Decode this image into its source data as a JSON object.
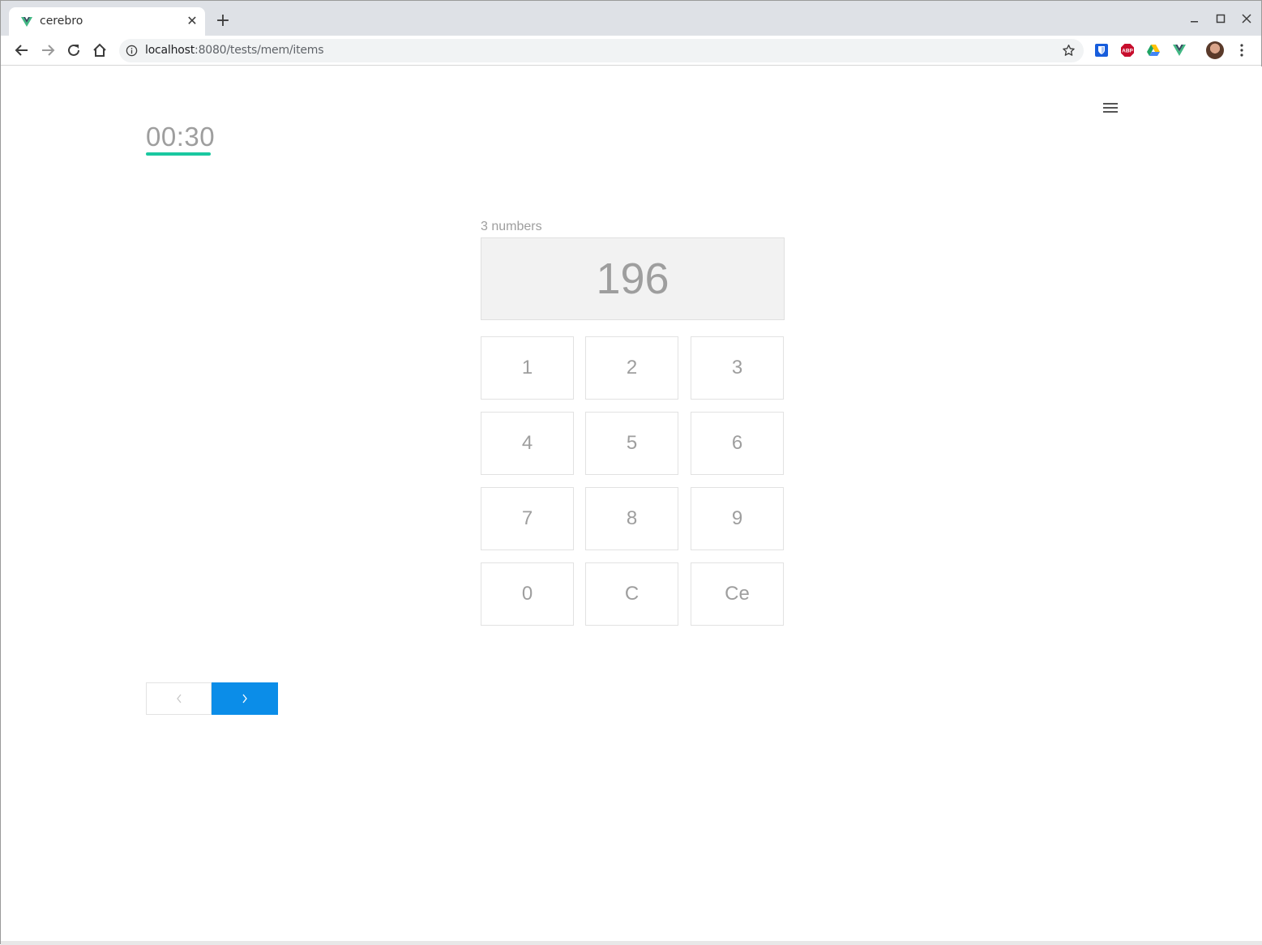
{
  "browser": {
    "tab_title": "cerebro",
    "tab_close": "✕",
    "new_tab": "+",
    "url_host": "localhost",
    "url_path": ":8080/tests/mem/items",
    "extensions": [
      "bitwarden-icon",
      "adblock-plus-icon",
      "google-drive-icon",
      "vue-devtools-icon"
    ],
    "abp_label": "ABP"
  },
  "page": {
    "timer": "00:30",
    "count_label": "3 numbers",
    "display_value": "196",
    "keypad": [
      "1",
      "2",
      "3",
      "4",
      "5",
      "6",
      "7",
      "8",
      "9",
      "0",
      "C",
      "Ce"
    ]
  },
  "colors": {
    "accent_green": "#1ac8a0",
    "next_button": "#0b8de8",
    "muted_text": "#9e9e9e"
  }
}
